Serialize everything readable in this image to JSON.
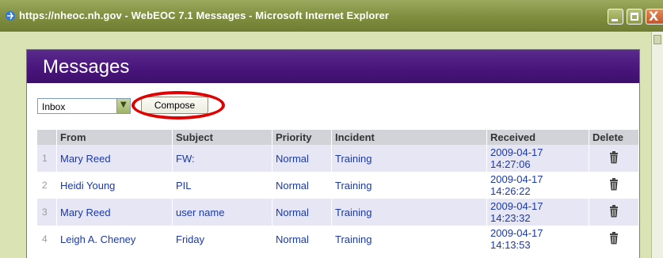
{
  "window": {
    "title": "https://nheoc.nh.gov - WebEOC 7.1  Messages - Microsoft Internet Explorer",
    "icons": {
      "app": "ie-icon",
      "minimize": "minimize-icon",
      "maximize": "maximize-icon",
      "close": "close-icon"
    },
    "close_glyph": "X"
  },
  "panel": {
    "title": "Messages",
    "header_color": "#48157a"
  },
  "toolbar": {
    "folder_value": "Inbox",
    "dropdown_glyph": "▼",
    "compose_label": "Compose",
    "highlight_color": "#e00000"
  },
  "table": {
    "headers": {
      "from": "From",
      "subject": "Subject",
      "priority": "Priority",
      "incident": "Incident",
      "received": "Received",
      "delete": "Delete"
    },
    "rows": [
      {
        "index": "1",
        "from": "Mary Reed",
        "subject": "FW:",
        "priority": "Normal",
        "incident": "Training",
        "received_date": "2009-04-17",
        "received_time": "14:27:06"
      },
      {
        "index": "2",
        "from": "Heidi Young",
        "subject": "PIL",
        "priority": "Normal",
        "incident": "Training",
        "received_date": "2009-04-17",
        "received_time": "14:26:22"
      },
      {
        "index": "3",
        "from": "Mary Reed",
        "subject": "user name",
        "priority": "Normal",
        "incident": "Training",
        "received_date": "2009-04-17",
        "received_time": "14:23:32"
      },
      {
        "index": "4",
        "from": "Leigh A. Cheney",
        "subject": "Friday",
        "priority": "Normal",
        "incident": "Training",
        "received_date": "2009-04-17",
        "received_time": "14:13:53"
      }
    ]
  }
}
